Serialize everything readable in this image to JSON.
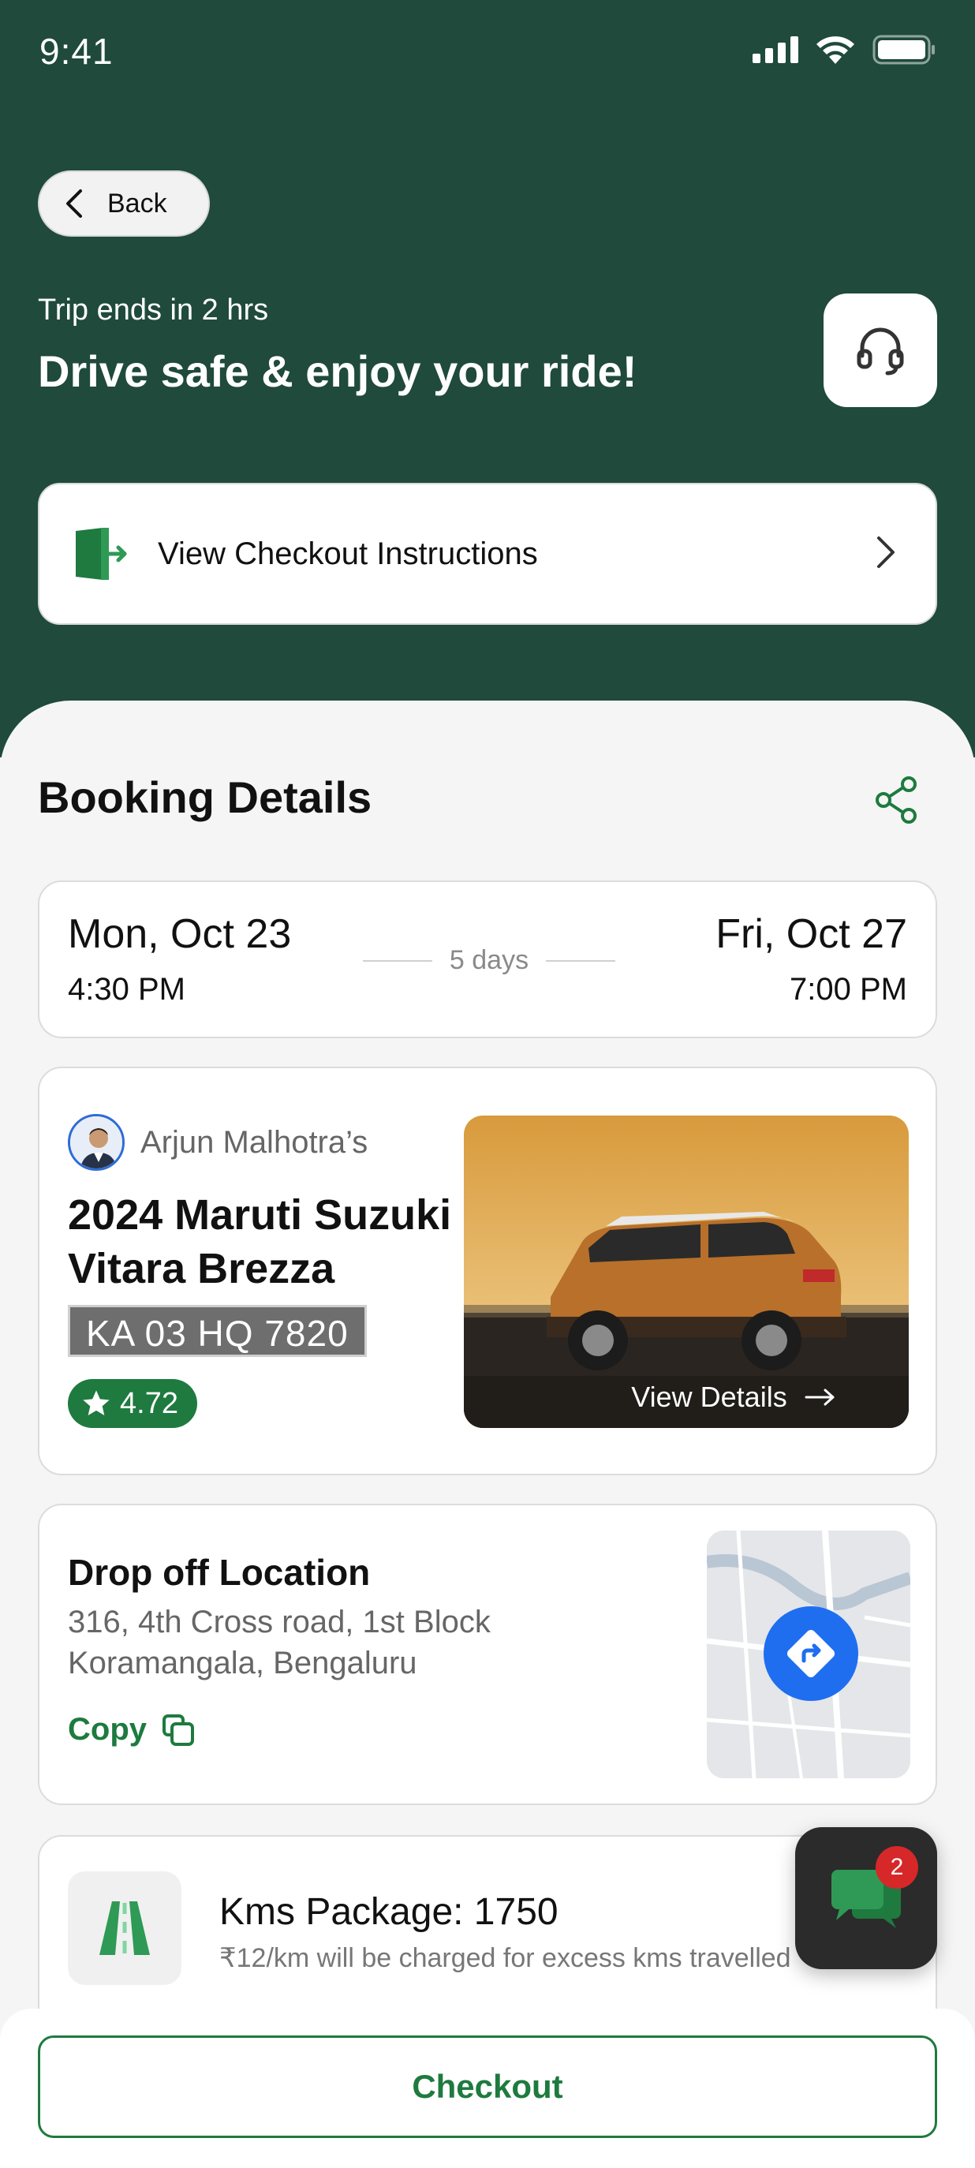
{
  "status_bar": {
    "time": "9:41"
  },
  "header": {
    "back_label": "Back",
    "trip_subtitle": "Trip ends in 2 hrs",
    "trip_title": "Drive safe & enjoy your ride!",
    "instructions_label": "View Checkout Instructions"
  },
  "booking": {
    "title": "Booking Details",
    "start_date": "Mon, Oct 23",
    "start_time": "4:30 PM",
    "duration": "5 days",
    "end_date": "Fri, Oct 27",
    "end_time": "7:00 PM"
  },
  "car": {
    "owner": "Arjun Malhotra’s",
    "name": "2024 Maruti Suzuki Vitara Brezza",
    "plate": "KA 03 HQ 7820",
    "rating": "4.72",
    "view_details": "View Details"
  },
  "dropoff": {
    "title": "Drop off Location",
    "address_line1": "316, 4th Cross road, 1st Block",
    "address_line2": "Koramangala, Bengaluru",
    "copy_label": "Copy"
  },
  "kms": {
    "title": "Kms Package: 1750",
    "subtitle": "₹12/km will be charged for excess kms travelled"
  },
  "chat": {
    "badge": "2"
  },
  "footer": {
    "checkout_label": "Checkout"
  },
  "colors": {
    "primary_dark": "#1f4a3c",
    "accent_green": "#1e7a3f",
    "nav_blue": "#1f6ef0",
    "badge_red": "#d62828"
  },
  "icons": [
    "signal-icon",
    "wifi-icon",
    "battery-icon",
    "chevron-left-icon",
    "headset-icon",
    "exit-door-icon",
    "chevron-right-icon",
    "share-icon",
    "star-icon",
    "arrow-right-icon",
    "copy-icon",
    "directions-icon",
    "road-icon",
    "chat-icon"
  ]
}
